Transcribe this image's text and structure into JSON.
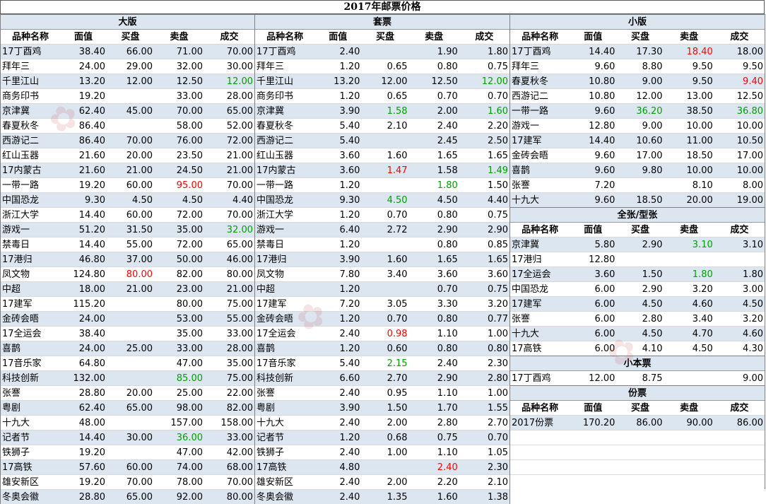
{
  "title": "2017年邮票价格",
  "columns": [
    "品种名称",
    "面值",
    "买盘",
    "卖盘",
    "成交"
  ],
  "colors": {
    "row_alt": "#dce6f1",
    "up": "#ff0000",
    "down": "#00a000"
  },
  "sections": {
    "large": {
      "title": "大版",
      "rows": [
        {
          "name": "17丁酉鸡",
          "face": "38.40",
          "bid": "66.00",
          "ask": "71.00",
          "deal": "70.00"
        },
        {
          "name": "拜年三",
          "face": "24.00",
          "bid": "29.00",
          "ask": "32.00",
          "deal": "30.00"
        },
        {
          "name": "千里江山",
          "face": "13.20",
          "bid": "12.00",
          "ask": "12.50",
          "deal": "12.00",
          "deal_c": "green"
        },
        {
          "name": "商务印书",
          "face": "19.20",
          "bid": "",
          "ask": "33.00",
          "deal": "28.00"
        },
        {
          "name": "京津冀",
          "face": "62.40",
          "bid": "45.00",
          "ask": "70.00",
          "deal": "65.00"
        },
        {
          "name": "春夏秋冬",
          "face": "86.40",
          "bid": "",
          "ask": "58.00",
          "deal": "52.00"
        },
        {
          "name": "西游记二",
          "face": "86.40",
          "bid": "70.00",
          "ask": "76.00",
          "deal": "72.00"
        },
        {
          "name": "红山玉器",
          "face": "21.60",
          "bid": "20.00",
          "ask": "23.50",
          "deal": "21.00"
        },
        {
          "name": "17内蒙古",
          "face": "21.60",
          "bid": "21.00",
          "ask": "24.50",
          "deal": "21.00"
        },
        {
          "name": "一带一路",
          "face": "19.20",
          "bid": "60.00",
          "ask": "95.00",
          "deal": "70.00",
          "ask_c": "red"
        },
        {
          "name": "中国恐龙",
          "face": "9.30",
          "bid": "4.50",
          "ask": "4.50",
          "deal": "4.40"
        },
        {
          "name": "浙江大学",
          "face": "14.40",
          "bid": "60.00",
          "ask": "72.00",
          "deal": "70.00"
        },
        {
          "name": "游戏一",
          "face": "51.20",
          "bid": "31.50",
          "ask": "35.00",
          "deal": "32.00",
          "deal_c": "green"
        },
        {
          "name": "禁毒日",
          "face": "14.40",
          "bid": "55.00",
          "ask": "72.00",
          "deal": "65.00"
        },
        {
          "name": "17港归",
          "face": "46.80",
          "bid": "37.00",
          "ask": "50.00",
          "deal": "46.00"
        },
        {
          "name": "凤文物",
          "face": "124.80",
          "bid": "80.00",
          "ask": "82.00",
          "deal": "80.00",
          "bid_c": "red"
        },
        {
          "name": "中超",
          "face": "18.00",
          "bid": "21.00",
          "ask": "23.00",
          "deal": "21.00"
        },
        {
          "name": "17建军",
          "face": "115.20",
          "bid": "",
          "ask": "80.00",
          "deal": "75.00"
        },
        {
          "name": "金砖会晤",
          "face": "24.00",
          "bid": "",
          "ask": "53.00",
          "deal": "55.00"
        },
        {
          "name": "17全运会",
          "face": "38.40",
          "bid": "",
          "ask": "35.00",
          "deal": "33.00"
        },
        {
          "name": "喜鹊",
          "face": "24.00",
          "bid": "25.00",
          "ask": "33.00",
          "deal": "28.00"
        },
        {
          "name": "17音乐家",
          "face": "64.80",
          "bid": "",
          "ask": "47.00",
          "deal": "35.00"
        },
        {
          "name": "科技创新",
          "face": "132.00",
          "bid": "",
          "ask": "85.00",
          "deal": "75.00",
          "ask_c": "green"
        },
        {
          "name": "张謇",
          "face": "28.80",
          "bid": "20.00",
          "ask": "25.00",
          "deal": "22.00"
        },
        {
          "name": "粤剧",
          "face": "62.40",
          "bid": "65.00",
          "ask": "98.00",
          "deal": "82.00"
        },
        {
          "name": "十九大",
          "face": "48.00",
          "bid": "",
          "ask": "157.00",
          "deal": "158.00"
        },
        {
          "name": "记者节",
          "face": "14.40",
          "bid": "30.00",
          "ask": "36.00",
          "deal": "33.00",
          "ask_c": "green"
        },
        {
          "name": "铁狮子",
          "face": "19.20",
          "bid": "",
          "ask": "47.00",
          "deal": "42.00"
        },
        {
          "name": "17高铁",
          "face": "57.60",
          "bid": "60.00",
          "ask": "74.00",
          "deal": "68.00"
        },
        {
          "name": "雄安新区",
          "face": "19.20",
          "bid": "70.00",
          "ask": "78.00",
          "deal": "70.00"
        },
        {
          "name": "冬奥会徽",
          "face": "28.80",
          "bid": "65.00",
          "ask": "92.00",
          "deal": "80.00"
        }
      ]
    },
    "sets": {
      "title": "套票",
      "rows": [
        {
          "name": "17丁酉鸡",
          "face": "2.40",
          "bid": "",
          "ask": "1.90",
          "deal": "1.80"
        },
        {
          "name": "拜年三",
          "face": "1.20",
          "bid": "0.65",
          "ask": "0.80",
          "deal": "0.75"
        },
        {
          "name": "千里江山",
          "face": "13.20",
          "bid": "12.00",
          "ask": "12.50",
          "deal": "12.00",
          "deal_c": "green"
        },
        {
          "name": "商务印书",
          "face": "1.20",
          "bid": "0.65",
          "ask": "0.70",
          "deal": "0.70"
        },
        {
          "name": "京津冀",
          "face": "3.90",
          "bid": "1.58",
          "ask": "2.00",
          "deal": "1.60",
          "bid_c": "green",
          "deal_c": "green"
        },
        {
          "name": "春夏秋冬",
          "face": "5.40",
          "bid": "2.10",
          "ask": "2.40",
          "deal": "2.20"
        },
        {
          "name": "西游记二",
          "face": "5.40",
          "bid": "",
          "ask": "2.45",
          "deal": "2.50"
        },
        {
          "name": "红山玉器",
          "face": "3.60",
          "bid": "1.60",
          "ask": "1.65",
          "deal": "1.65"
        },
        {
          "name": "17内蒙古",
          "face": "3.60",
          "bid": "1.47",
          "ask": "1.58",
          "deal": "1.49",
          "bid_c": "red",
          "deal_c": "green"
        },
        {
          "name": "一带一路",
          "face": "1.20",
          "bid": "",
          "ask": "1.80",
          "deal": "1.50",
          "ask_c": "green"
        },
        {
          "name": "中国恐龙",
          "face": "9.30",
          "bid": "4.50",
          "ask": "4.50",
          "deal": "4.40",
          "bid_c": "green"
        },
        {
          "name": "浙江大学",
          "face": "1.20",
          "bid": "0.70",
          "ask": "0.80",
          "deal": "0.75"
        },
        {
          "name": "游戏一",
          "face": "6.40",
          "bid": "2.72",
          "ask": "2.90",
          "deal": "2.90"
        },
        {
          "name": "禁毒日",
          "face": "1.20",
          "bid": "",
          "ask": "0.80",
          "deal": "0.85"
        },
        {
          "name": "17港归",
          "face": "3.90",
          "bid": "1.60",
          "ask": "1.65",
          "deal": "1.65"
        },
        {
          "name": "凤文物",
          "face": "7.80",
          "bid": "3.40",
          "ask": "3.60",
          "deal": "3.60"
        },
        {
          "name": "中超",
          "face": "1.20",
          "bid": "",
          "ask": "0.70",
          "deal": "0.75"
        },
        {
          "name": "17建军",
          "face": "7.20",
          "bid": "3.05",
          "ask": "3.30",
          "deal": "3.20"
        },
        {
          "name": "金砖会晤",
          "face": "1.20",
          "bid": "0.70",
          "ask": "0.80",
          "deal": "0.77"
        },
        {
          "name": "17全运会",
          "face": "2.40",
          "bid": "0.98",
          "ask": "1.10",
          "deal": "1.00",
          "bid_c": "red"
        },
        {
          "name": "喜鹊",
          "face": "1.20",
          "bid": "0.60",
          "ask": "0.80",
          "deal": "0.80"
        },
        {
          "name": "17音乐家",
          "face": "5.40",
          "bid": "2.15",
          "ask": "2.40",
          "deal": "2.30",
          "bid_c": "green"
        },
        {
          "name": "科技创新",
          "face": "6.60",
          "bid": "2.70",
          "ask": "2.90",
          "deal": "2.80"
        },
        {
          "name": "张謇",
          "face": "2.40",
          "bid": "0.95",
          "ask": "1.10",
          "deal": "1.00"
        },
        {
          "name": "粤剧",
          "face": "3.90",
          "bid": "1.50",
          "ask": "1.70",
          "deal": "1.55"
        },
        {
          "name": "十九大",
          "face": "2.40",
          "bid": "2.00",
          "ask": "2.80",
          "deal": "2.70"
        },
        {
          "name": "记者节",
          "face": "1.20",
          "bid": "0.68",
          "ask": "0.75",
          "deal": "0.70"
        },
        {
          "name": "铁狮子",
          "face": "2.40",
          "bid": "1.00",
          "ask": "1.10",
          "deal": "1.05"
        },
        {
          "name": "17高铁",
          "face": "4.80",
          "bid": "",
          "ask": "2.40",
          "deal": "2.30",
          "ask_c": "red"
        },
        {
          "name": "雄安新区",
          "face": "2.40",
          "bid": "2.00",
          "ask": "2.20",
          "deal": "2.10"
        },
        {
          "name": "冬奥会徽",
          "face": "2.40",
          "bid": "1.35",
          "ask": "1.60",
          "deal": "1.38"
        }
      ]
    },
    "small": {
      "title": "小版",
      "rows": [
        {
          "name": "17丁酉鸡",
          "face": "14.40",
          "bid": "17.30",
          "ask": "18.40",
          "deal": "18.00",
          "ask_c": "red"
        },
        {
          "name": "拜年三",
          "face": "9.60",
          "bid": "8.80",
          "ask": "9.50",
          "deal": "9.50"
        },
        {
          "name": "春夏秋冬",
          "face": "10.80",
          "bid": "9.00",
          "ask": "9.50",
          "deal": "9.40",
          "deal_c": "red"
        },
        {
          "name": "西游记二",
          "face": "10.80",
          "bid": "12.00",
          "ask": "13.00",
          "deal": "12.50"
        },
        {
          "name": "一带一路",
          "face": "9.60",
          "bid": "36.20",
          "ask": "38.50",
          "deal": "36.80",
          "bid_c": "green",
          "deal_c": "green"
        },
        {
          "name": "游戏一",
          "face": "12.80",
          "bid": "9.00",
          "ask": "10.00",
          "deal": "10.00"
        },
        {
          "name": "17建军",
          "face": "14.40",
          "bid": "10.60",
          "ask": "11.00",
          "deal": "10.50"
        },
        {
          "name": "金砖会晤",
          "face": "9.60",
          "bid": "17.00",
          "ask": "18.50",
          "deal": "17.00"
        },
        {
          "name": "喜鹊",
          "face": "9.60",
          "bid": "9.80",
          "ask": "10.00",
          "deal": "10.00"
        },
        {
          "name": "张謇",
          "face": "7.20",
          "bid": "",
          "ask": "8.10",
          "deal": "8.00"
        },
        {
          "name": "十九大",
          "face": "9.60",
          "bid": "18.50",
          "ask": "20.00",
          "deal": "19.00"
        }
      ]
    },
    "full_sheet": {
      "title": "全张/型张",
      "rows": [
        {
          "name": "京津冀",
          "face": "5.80",
          "bid": "2.90",
          "ask": "3.10",
          "deal": "3.10",
          "ask_c": "green"
        },
        {
          "name": "17港归",
          "face": "12.80",
          "bid": "",
          "ask": "",
          "deal": ""
        },
        {
          "name": "17全运会",
          "face": "3.60",
          "bid": "1.50",
          "ask": "1.80",
          "deal": "1.80",
          "ask_c": "green"
        },
        {
          "name": "中国恐龙",
          "face": "6.00",
          "bid": "2.90",
          "ask": "3.20",
          "deal": "3.00"
        },
        {
          "name": "17建军",
          "face": "6.00",
          "bid": "4.50",
          "ask": "4.60",
          "deal": "4.50"
        },
        {
          "name": "张謇",
          "face": "6.00",
          "bid": "2.80",
          "ask": "3.40",
          "deal": "3.20"
        },
        {
          "name": "十九大",
          "face": "6.00",
          "bid": "4.50",
          "ask": "4.70",
          "deal": "4.60"
        },
        {
          "name": "17高铁",
          "face": "6.00",
          "bid": "4.10",
          "ask": "4.50",
          "deal": "4.30"
        }
      ]
    },
    "booklet": {
      "title": "小本票",
      "rows": [
        {
          "name": "17丁酉鸡",
          "face": "12.00",
          "bid": "8.75",
          "ask": "",
          "deal": "9.00"
        }
      ]
    },
    "year_set": {
      "title": "份票",
      "rows": [
        {
          "name": "2017份票",
          "face": "170.20",
          "bid": "86.00",
          "ask": "90.00",
          "deal": "86.00"
        }
      ]
    }
  }
}
